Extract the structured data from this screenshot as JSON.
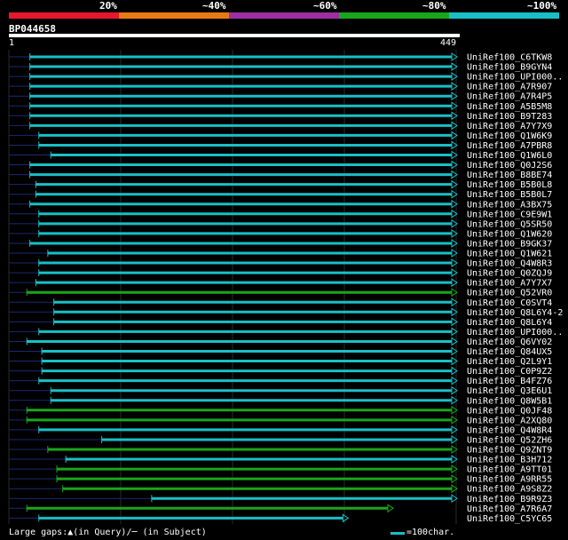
{
  "legend": {
    "labels": [
      "20%",
      "~40%",
      "~60%",
      "~80%",
      "~100%"
    ],
    "colors": [
      "#e8182c",
      "#e87a16",
      "#9c2fa2",
      "#1aa61a",
      "#18c0c6"
    ]
  },
  "query": {
    "name": "BP044658",
    "start": "1",
    "end": "449"
  },
  "hits": [
    {
      "label": "UniRef100_C6TKW8",
      "start": 22,
      "end": 449,
      "color": "cyan"
    },
    {
      "label": "UniRef100_B9GYN4",
      "start": 22,
      "end": 449,
      "color": "cyan"
    },
    {
      "label": "UniRef100_UPI000..",
      "start": 22,
      "end": 449,
      "color": "cyan"
    },
    {
      "label": "UniRef100_A7R907",
      "start": 22,
      "end": 449,
      "color": "cyan"
    },
    {
      "label": "UniRef100_A7R4P5",
      "start": 22,
      "end": 449,
      "color": "cyan"
    },
    {
      "label": "UniRef100_A5B5M8",
      "start": 22,
      "end": 449,
      "color": "cyan"
    },
    {
      "label": "UniRef100_B9T283",
      "start": 22,
      "end": 449,
      "color": "cyan"
    },
    {
      "label": "UniRef100_A7Y7X9",
      "start": 22,
      "end": 449,
      "color": "cyan"
    },
    {
      "label": "UniRef100_Q1W6K9",
      "start": 31,
      "end": 449,
      "color": "cyan"
    },
    {
      "label": "UniRef100_A7PBR8",
      "start": 31,
      "end": 449,
      "color": "cyan"
    },
    {
      "label": "UniRef100_Q1W6L0",
      "start": 43,
      "end": 449,
      "color": "cyan"
    },
    {
      "label": "UniRef100_Q0J2S6",
      "start": 22,
      "end": 449,
      "color": "cyan"
    },
    {
      "label": "UniRef100_B8BE74",
      "start": 22,
      "end": 449,
      "color": "cyan"
    },
    {
      "label": "UniRef100_B5B0L8",
      "start": 28,
      "end": 449,
      "color": "cyan"
    },
    {
      "label": "UniRef100_B5B0L7",
      "start": 28,
      "end": 449,
      "color": "cyan"
    },
    {
      "label": "UniRef100_A3BX75",
      "start": 22,
      "end": 449,
      "color": "cyan"
    },
    {
      "label": "UniRef100_C9E9W1",
      "start": 31,
      "end": 449,
      "color": "cyan"
    },
    {
      "label": "UniRef100_Q5SR50",
      "start": 31,
      "end": 449,
      "color": "cyan"
    },
    {
      "label": "UniRef100_Q1W620",
      "start": 31,
      "end": 449,
      "color": "cyan"
    },
    {
      "label": "UniRef100_B9GK37",
      "start": 22,
      "end": 449,
      "color": "cyan"
    },
    {
      "label": "UniRef100_Q1W621",
      "start": 40,
      "end": 449,
      "color": "cyan"
    },
    {
      "label": "UniRef100_Q4W8R3",
      "start": 31,
      "end": 449,
      "color": "cyan"
    },
    {
      "label": "UniRef100_Q0ZQJ9",
      "start": 31,
      "end": 449,
      "color": "cyan"
    },
    {
      "label": "UniRef100_A7Y7X7",
      "start": 28,
      "end": 449,
      "color": "cyan"
    },
    {
      "label": "UniRef100_Q52VR0",
      "start": 19,
      "end": 449,
      "color": "green"
    },
    {
      "label": "UniRef100_C0SVT4",
      "start": 46,
      "end": 449,
      "color": "cyan"
    },
    {
      "label": "UniRef100_Q8L6Y4-2",
      "start": 46,
      "end": 449,
      "color": "cyan"
    },
    {
      "label": "UniRef100_Q8L6Y4",
      "start": 46,
      "end": 449,
      "color": "cyan"
    },
    {
      "label": "UniRef100_UPI000..",
      "start": 31,
      "end": 449,
      "color": "cyan"
    },
    {
      "label": "UniRef100_Q6VY02",
      "start": 19,
      "end": 449,
      "color": "cyan"
    },
    {
      "label": "UniRef100_Q84UX5",
      "start": 34,
      "end": 449,
      "color": "cyan"
    },
    {
      "label": "UniRef100_Q2L9Y1",
      "start": 34,
      "end": 449,
      "color": "cyan"
    },
    {
      "label": "UniRef100_C0P9Z2",
      "start": 34,
      "end": 449,
      "color": "cyan"
    },
    {
      "label": "UniRef100_B4FZ76",
      "start": 31,
      "end": 449,
      "color": "cyan"
    },
    {
      "label": "UniRef100_Q3E6U1",
      "start": 43,
      "end": 449,
      "color": "cyan"
    },
    {
      "label": "UniRef100_Q8W5B1",
      "start": 43,
      "end": 449,
      "color": "cyan"
    },
    {
      "label": "UniRef100_Q0JF48",
      "start": 19,
      "end": 449,
      "color": "green"
    },
    {
      "label": "UniRef100_A2XQ80",
      "start": 19,
      "end": 449,
      "color": "green"
    },
    {
      "label": "UniRef100_Q4W8R4",
      "start": 31,
      "end": 449,
      "color": "cyan"
    },
    {
      "label": "UniRef100_Q52ZH6",
      "start": 94,
      "end": 449,
      "color": "cyan"
    },
    {
      "label": "UniRef100_Q9ZNT9",
      "start": 40,
      "end": 449,
      "color": "green"
    },
    {
      "label": "UniRef100_B3H712",
      "start": 58,
      "end": 449,
      "color": "cyan"
    },
    {
      "label": "UniRef100_A9TT01",
      "start": 49,
      "end": 449,
      "color": "green"
    },
    {
      "label": "UniRef100_A9RR55",
      "start": 49,
      "end": 449,
      "color": "green"
    },
    {
      "label": "UniRef100_A9S8Z2",
      "start": 55,
      "end": 449,
      "color": "green"
    },
    {
      "label": "UniRef100_B9R9Z3",
      "start": 144,
      "end": 449,
      "color": "cyan"
    },
    {
      "label": "UniRef100_A7R6A7",
      "start": 19,
      "end": 385,
      "color": "green"
    },
    {
      "label": "UniRef100_C5YC65",
      "start": 31,
      "end": 340,
      "color": "cyan"
    }
  ],
  "footer": {
    "gaps_text": "Large gaps:▲(in Query)/─ (in Subject)",
    "scale_text": "=100char."
  }
}
